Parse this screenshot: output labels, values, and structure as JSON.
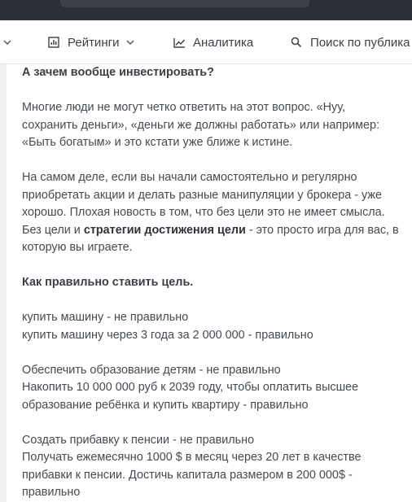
{
  "nav": {
    "items": [
      {
        "label": "Рейтинги",
        "icon": "bar-chart-icon",
        "has_dropdown": true
      },
      {
        "label": "Аналитика",
        "icon": "line-chart-icon",
        "has_dropdown": false
      },
      {
        "label": "Поиск по публика",
        "icon": "search-icon",
        "has_dropdown": false
      }
    ]
  },
  "article": {
    "heading1": "А зачем вообще инвестировать?",
    "p1": {
      "l1": "Многие люди не могут четко ответить на этот вопрос. «Нуу,",
      "l2": "сохранить деньги», «деньги же должны работать» или например:",
      "l3": "«Быть богатым» и это кстати уже ближе к истине."
    },
    "p2": {
      "l1": "На самом деле, если вы начали самостоятельно и регулярно",
      "l2": "приобретать акции и делать разные манипуляции у брокера - уже",
      "l3": "хорошо. Плохая новость в том, что без цели это не имеет смысла.",
      "l4_before": "Без цели и ",
      "l4_bold": "стратегии достижения цели",
      "l4_after": " - это просто игра для вас, в",
      "l5": "которую вы играете."
    },
    "heading2": "Как правильно ставить цель.",
    "p3": {
      "l1": "купить машину - не правильно",
      "l2": "купить машину через 3 года за 2 000 000 - правильно"
    },
    "p4": {
      "l1": "Обеспечить образование детям - не правильно",
      "l2": "Накопить 10 000 000 руб к 2039 году, чтобы оплатить высшее",
      "l3": "образование ребёнка и купить квартиру - правильно"
    },
    "p5": {
      "l1": "Создать прибавку к пенсии - не правильно",
      "l2": "Получать ежемесячно 1000 $ в месяц через 20 лет в качестве",
      "l3": "прибавки к пенсии. Достичь капитала размером в 200 000$ -",
      "l4": "правильно"
    }
  }
}
